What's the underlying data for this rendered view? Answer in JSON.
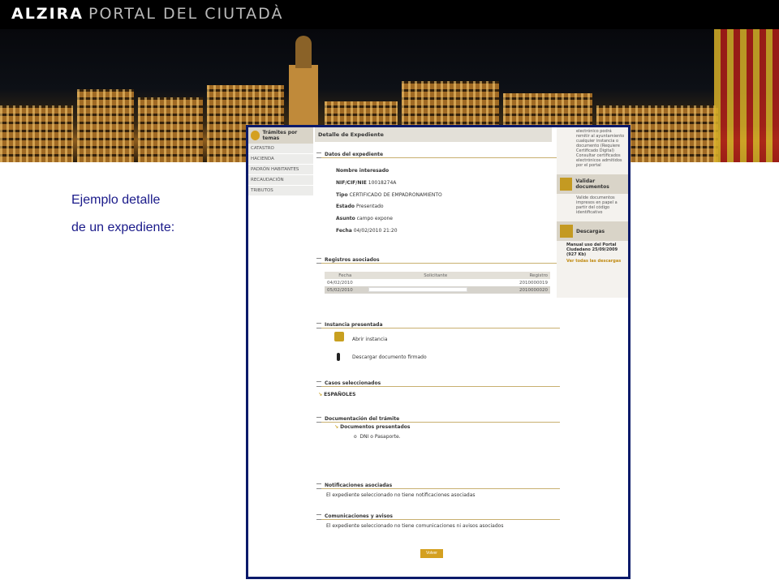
{
  "header": {
    "brand": "ALZIRA",
    "subtitle": "PORTAL DEL CIUTADÀ"
  },
  "caption": {
    "line1": "Ejemplo detalle",
    "line2": "de un expediente:"
  },
  "left_nav": {
    "title": "Trámites por temas",
    "items": [
      "CATASTRO",
      "HACIENDA",
      "PADRÓN HABITANTES",
      "RECAUDACIÓN",
      "TRIBUTOS"
    ]
  },
  "detail": {
    "title": "Detalle de Expediente",
    "datos": {
      "heading": "Datos del expediente",
      "nombre_label": "Nombre interesado",
      "nif_label": "NIF/CIF/NIE",
      "nif_value": "10018274A",
      "tipo_label": "Tipo",
      "tipo_value": "CERTIFICADO DE EMPADRONAMIENTO",
      "estado_label": "Estado",
      "estado_value": "Presentado",
      "asunto_label": "Asunto",
      "asunto_value": "campo expone",
      "fecha_label": "Fecha",
      "fecha_value": "04/02/2010 21:20"
    },
    "registros": {
      "heading": "Registros asociados",
      "columns": [
        "Fecha",
        "Solicitante",
        "Registro"
      ],
      "rows": [
        {
          "fecha": "04/02/2010",
          "registro": "2010000019"
        },
        {
          "fecha": "05/02/2010",
          "registro": "2010000020"
        }
      ]
    },
    "instancia": {
      "heading": "Instancia presentada",
      "open": "Abrir instancia",
      "download": "Descargar documento firmado"
    },
    "casos": {
      "heading": "Casos seleccionados",
      "item": "ESPAÑOLES"
    },
    "documentacion": {
      "heading": "Documentación del trámite",
      "sub": "Documentos presentados",
      "item": "DNI o Pasaporte."
    },
    "notificaciones": {
      "heading": "Notificaciones asociadas",
      "text": "El expediente seleccionado no tiene notificaciones asociadas"
    },
    "comunicaciones": {
      "heading": "Comunicaciones y avisos",
      "text": "El expediente seleccionado no tiene comunicaciones ni avisos asociados"
    },
    "back_button": "Volver"
  },
  "right_col": {
    "intro": "electrónico podrá remitir al ayuntamiento cualquier instancia o documento (Requiere Certificado Digital) Consultar certificados electrónicos admitidos por el portal",
    "validar_title": "Validar documentos",
    "validar_text": "Valide documentos impresos en papel a partir del código identificativo",
    "descargas_title": "Descargas",
    "manual": "Manual uso del Portal Ciudadano 25/09/2009 (927 Kb)",
    "ver_todas": "Ver todas las descargas"
  }
}
